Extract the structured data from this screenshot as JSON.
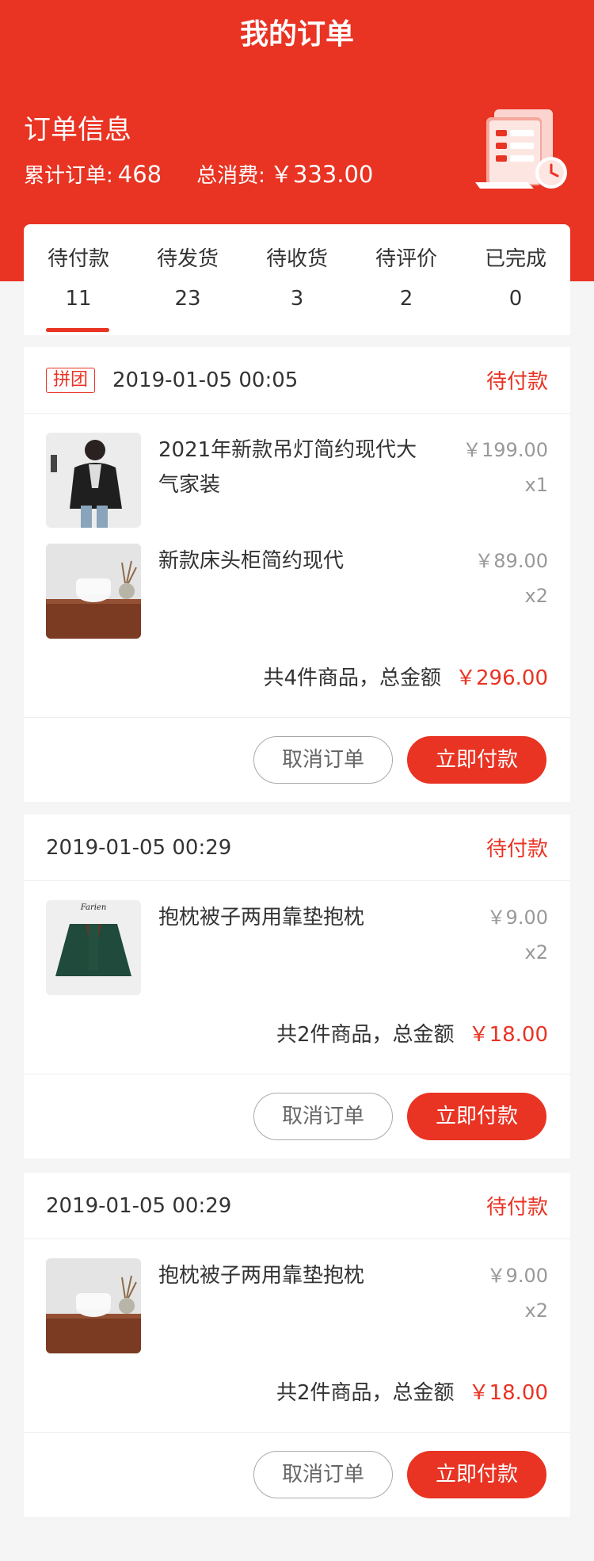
{
  "header": {
    "title": "我的订单",
    "info_title": "订单信息",
    "total_orders_label": "累计订单:",
    "total_orders": "468",
    "total_spent_label": "总消费:",
    "total_spent": "￥333.00"
  },
  "tabs": [
    {
      "label": "待付款",
      "count": "11"
    },
    {
      "label": "待发货",
      "count": "23"
    },
    {
      "label": "待收货",
      "count": "3"
    },
    {
      "label": "待评价",
      "count": "2"
    },
    {
      "label": "已完成",
      "count": "0"
    }
  ],
  "orders": [
    {
      "badge": "拼团",
      "time": "2019-01-05 00:05",
      "status": "待付款",
      "items": [
        {
          "name": "2021年新款吊灯简约现代大气家装",
          "price": "￥199.00",
          "qty": "x1",
          "image": "clothing-photo"
        },
        {
          "name": "新款床头柜简约现代",
          "price": "￥89.00",
          "qty": "x2",
          "image": "furniture-photo"
        }
      ],
      "summary": "共4件商品，总金额",
      "total": "￥296.00",
      "cancel": "取消订单",
      "pay": "立即付款"
    },
    {
      "time": "2019-01-05 00:29",
      "status": "待付款",
      "items": [
        {
          "name": "抱枕被子两用靠垫抱枕",
          "price": "￥9.00",
          "qty": "x2",
          "image": "jacket-photo"
        }
      ],
      "summary": "共2件商品，总金额",
      "total": "￥18.00",
      "cancel": "取消订单",
      "pay": "立即付款"
    },
    {
      "time": "2019-01-05 00:29",
      "status": "待付款",
      "items": [
        {
          "name": "抱枕被子两用靠垫抱枕",
          "price": "￥9.00",
          "qty": "x2",
          "image": "furniture-photo"
        }
      ],
      "summary": "共2件商品，总金额",
      "total": "￥18.00",
      "cancel": "取消订单",
      "pay": "立即付款"
    }
  ],
  "colors": {
    "accent": "#e93323",
    "background": "#f5f5f5"
  }
}
